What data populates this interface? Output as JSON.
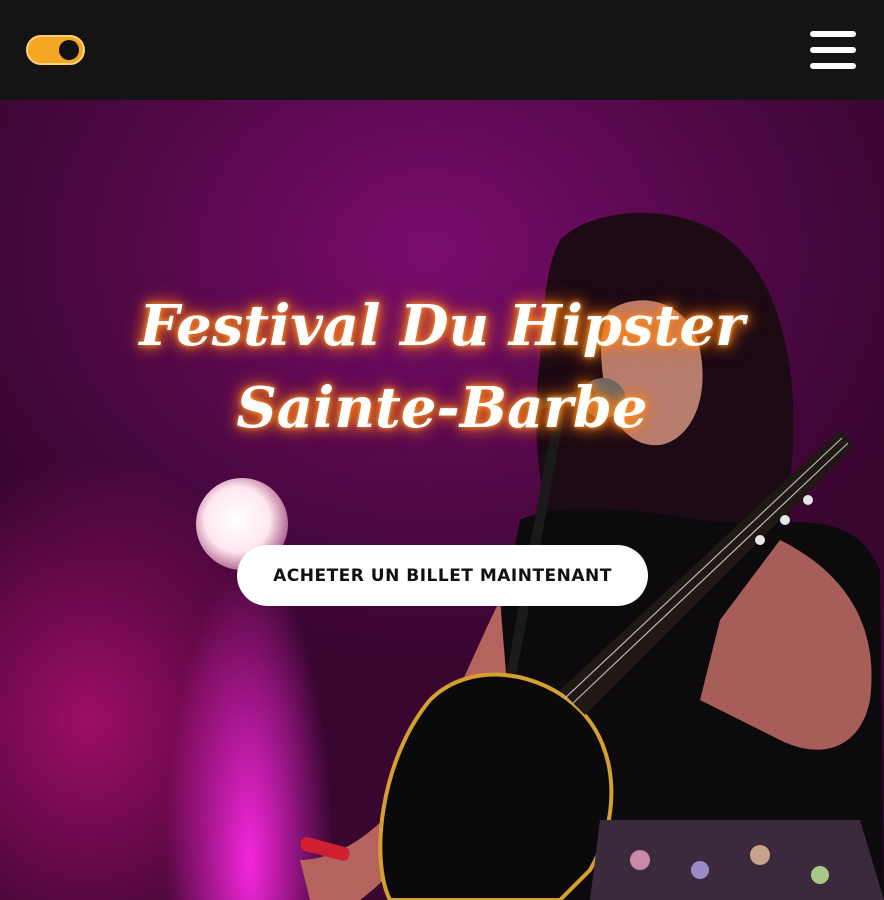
{
  "header": {
    "theme_toggle": {
      "state": "on",
      "track_color": "#f5a623",
      "knob_color": "#111111"
    },
    "menu_icon": "hamburger-menu-icon"
  },
  "hero": {
    "title": "Festival Du Hipster Sainte-Barbe",
    "cta_label": "ACHETER UN BILLET MAINTENANT",
    "background_image": "singer with acoustic guitar on stage under magenta light",
    "title_glow_color": "#ff8a1a"
  }
}
